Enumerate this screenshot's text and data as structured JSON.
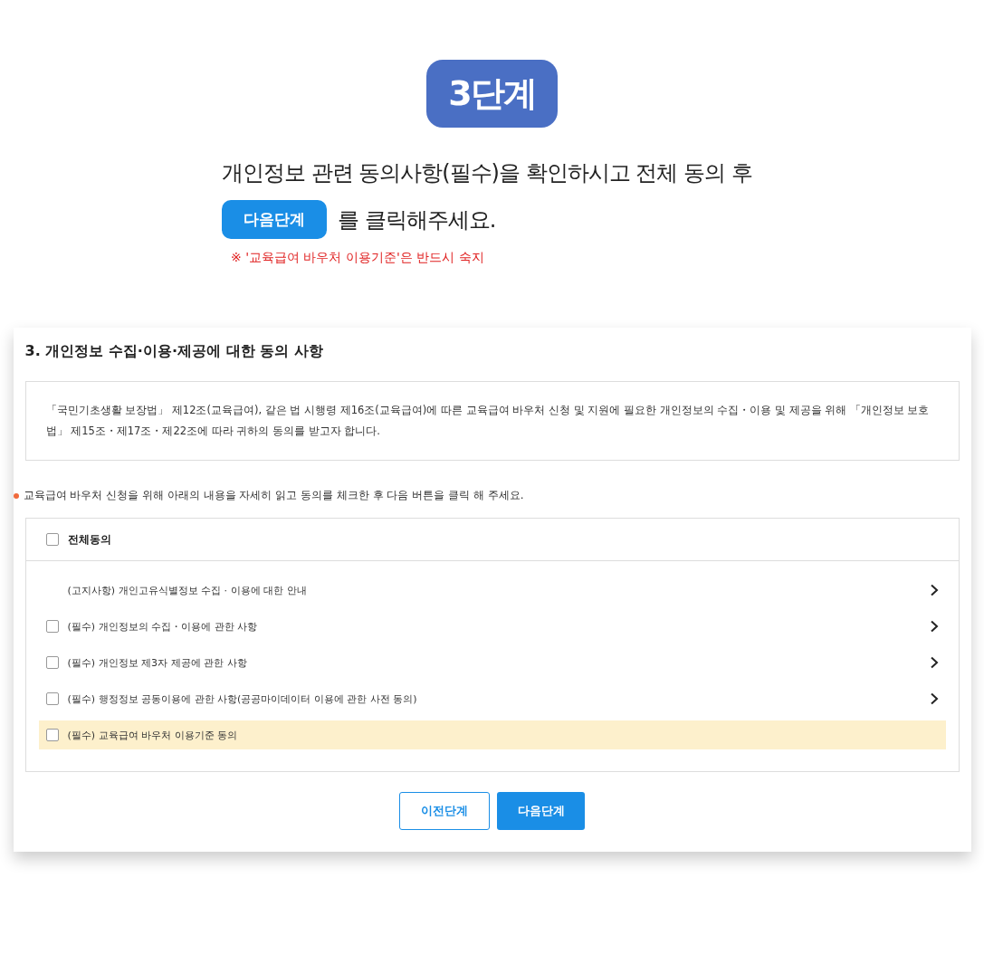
{
  "step_badge": "3단계",
  "instruction": {
    "line_1": "개인정보 관련 동의사항(필수)을 확인하시고 전체 동의 후",
    "button_label": "다음단계",
    "line_2": "를 클릭해주세요.",
    "note": "※ '교육급여 바우처 이용기준'은 반드시 숙지"
  },
  "section": {
    "title": "3. 개인정보 수집·이용·제공에 대한 동의 사항",
    "description": "「국민기초생활 보장법」 제12조(교육급여), 같은 법 시행령 제16조(교육급여)에 따른 교육급여 바우처 신청 및 지원에 필요한 개인정보의 수집・이용 및 제공을 위해 「개인정보 보호법」 제15조・제17조・제22조에 따라 귀하의 동의를 받고자 합니다.",
    "guide": "교육급여 바우처 신청을 위해 아래의 내용을 자세히 읽고 동의를 체크한 후 다음 버튼을 클릭 해 주세요.",
    "agree_all": {
      "label": "전체동의",
      "checked": false
    },
    "items": [
      {
        "kind": "notice",
        "label": "(고지사항) 개인고유식별정보 수집 · 이용에 대한 안내",
        "highlighted": false,
        "has_arrow": true
      },
      {
        "kind": "checkbox",
        "label": "(필수) 개인정보의 수집・이용에 관한 사항",
        "checked": false,
        "highlighted": false,
        "has_arrow": true
      },
      {
        "kind": "checkbox",
        "label": "(필수) 개인정보 제3자 제공에 관한 사항",
        "checked": false,
        "highlighted": false,
        "has_arrow": true
      },
      {
        "kind": "checkbox",
        "label": "(필수) 행정정보 공동이용에 관한 사항(공공마이데이터 이용에 관한 사전 동의)",
        "checked": false,
        "highlighted": false,
        "has_arrow": true
      },
      {
        "kind": "checkbox",
        "label": "(필수) 교육급여 바우처 이용기준 동의",
        "checked": false,
        "highlighted": true,
        "has_arrow": false
      }
    ],
    "buttons": [
      {
        "kind": "secondary",
        "label": "이전단계"
      },
      {
        "kind": "primary",
        "label": "다음단계"
      }
    ]
  }
}
